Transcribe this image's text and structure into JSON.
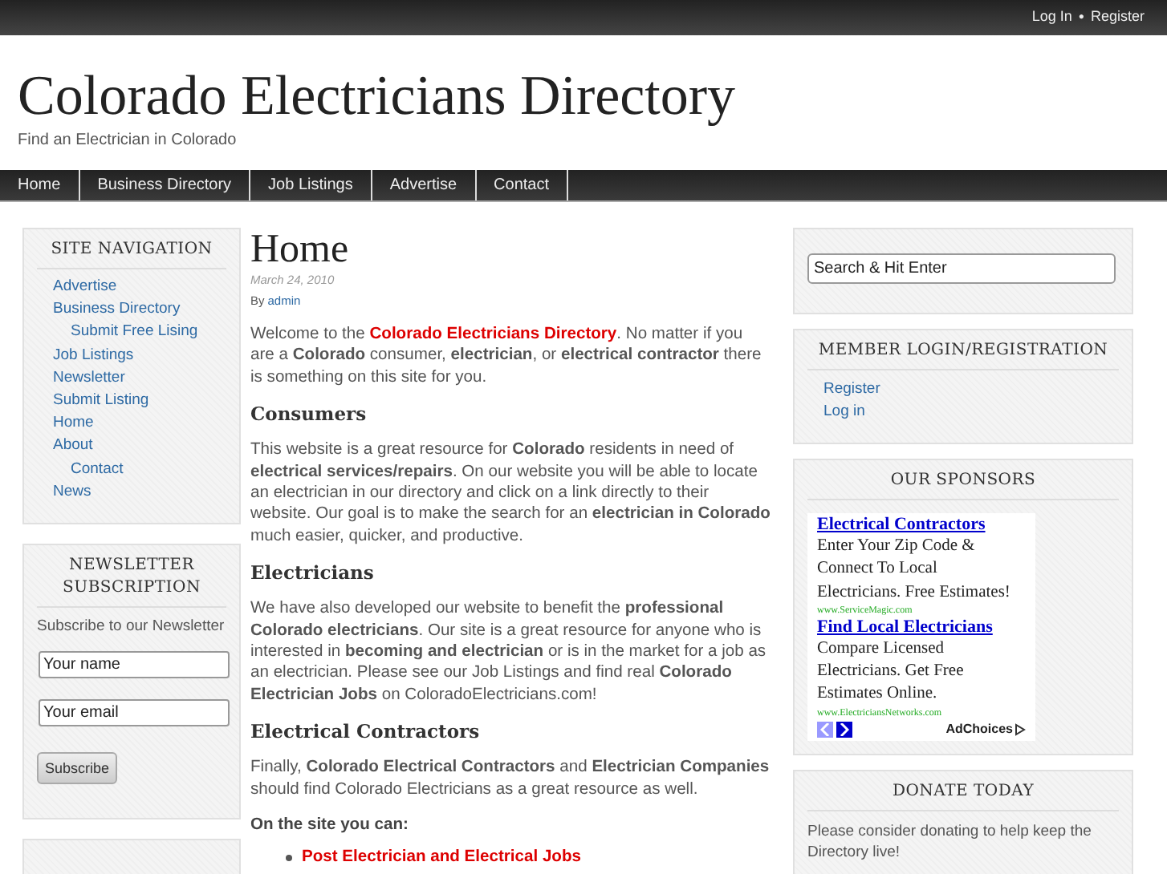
{
  "top_bar": {
    "links": [
      "Log In",
      "Register"
    ],
    "separator": "●"
  },
  "header": {
    "title": "Colorado Electricians Directory",
    "tagline": "Find an Electrician in Colorado"
  },
  "nav": [
    "Home",
    "Business Directory",
    "Job Listings",
    "Advertise",
    "Contact"
  ],
  "site_navigation": {
    "title": "SITE NAVIGATION",
    "items": [
      {
        "label": "Advertise"
      },
      {
        "label": "Business Directory",
        "children": [
          {
            "label": "Submit Free Lising"
          }
        ]
      },
      {
        "label": "Job Listings"
      },
      {
        "label": "Newsletter"
      },
      {
        "label": "Submit Listing"
      },
      {
        "label": "Home"
      },
      {
        "label": "About",
        "children": [
          {
            "label": "Contact"
          }
        ]
      },
      {
        "label": "News"
      }
    ]
  },
  "newsletter": {
    "title": "NEWSLETTER SUBSCRIPTION",
    "text": "Subscribe to our Newsletter",
    "fields": [
      {
        "value": "Your name"
      },
      {
        "value": "Your email"
      }
    ],
    "button": "Subscribe"
  },
  "post": {
    "title": "Home",
    "date": "March 24, 2010",
    "by": "By",
    "author": "admin",
    "blocks": [
      {
        "kind": "paragraph",
        "segments": [
          {
            "kind": "plain",
            "text": "Welcome to the "
          },
          {
            "kind": "link",
            "text": "Colorado Electricians Directory"
          },
          {
            "kind": "plain",
            "text": ".  No matter if you are a **Colorado** consumer, **electrician**, or **electrical contractor** there is something on this site for you."
          }
        ]
      },
      {
        "kind": "heading",
        "text": "Consumers"
      },
      {
        "kind": "paragraph",
        "segments": [
          {
            "kind": "plain",
            "text": "This website is a great resource for **Colorado** residents in need of **electrical services/repairs**.  On our website you will be able to locate an electrician in our directory and click on a link directly to their website.  Our goal is to make the search for an **electrician in Colorado** much easier, quicker, and productive."
          }
        ]
      },
      {
        "kind": "heading",
        "text": "Electricians"
      },
      {
        "kind": "paragraph",
        "segments": [
          {
            "kind": "plain",
            "text": "We have also developed our website to benefit the **professional Colorado electricians**.  Our site is a great resource for anyone who is interested in **becoming and electrician** or is in the market for a job as an electrician.  Please see our Job Listings and find real **Colorado Electrician Jobs** on ColoradoElectricians.com!"
          }
        ]
      },
      {
        "kind": "heading",
        "text": "Electrical Contractors"
      },
      {
        "kind": "paragraph",
        "segments": [
          {
            "kind": "plain",
            "text": "Finally, **Colorado Electrical Contractors** and **Electrician Companies** should find Colorado Electricians as a great resource as well."
          }
        ]
      },
      {
        "kind": "lead",
        "text": "On the site you can:"
      },
      {
        "kind": "bullet",
        "text": "Post Electrician and Electrical Jobs"
      }
    ]
  },
  "search": {
    "placeholder": "Search & Hit Enter"
  },
  "member": {
    "title": "MEMBER LOGIN/REGISTRATION",
    "links": [
      "Register",
      "Log in"
    ]
  },
  "sponsors": {
    "title": "OUR SPONSORS",
    "ads": [
      {
        "title": "Electrical Contractors",
        "body": "Enter Your Zip Code & Connect To Local Electricians. Free Estimates!",
        "url": "www.ServiceMagic.com"
      },
      {
        "title": "Find Local Electricians",
        "body": "Compare Licensed Electricians. Get Free Estimates Online.",
        "url": "www.ElectriciansNetworks.com"
      }
    ],
    "adchoices": "AdChoices"
  },
  "donate": {
    "title": "DONATE TODAY",
    "text": "Please consider donating to help keep the Directory live!"
  }
}
